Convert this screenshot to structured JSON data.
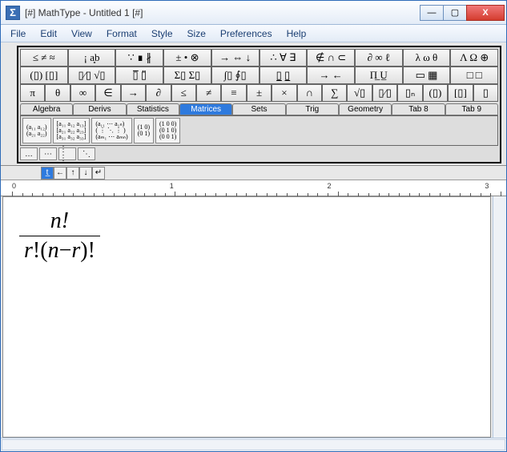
{
  "window": {
    "title": "[#] MathType - Untitled 1 [#]",
    "app_icon": "Σ"
  },
  "winbtns": {
    "min": "—",
    "max": "▢",
    "close": "X"
  },
  "menubar": [
    "File",
    "Edit",
    "View",
    "Format",
    "Style",
    "Size",
    "Preferences",
    "Help"
  ],
  "palette_rows": [
    [
      "≤ ≠ ≈",
      "¡ a͈b",
      "∵ ∎ ∦",
      "± • ⊗",
      "→ ⇔ ↓",
      "∴ ∀ ∃",
      "∉ ∩ ⊂",
      "∂ ∞ ℓ",
      "λ ω θ",
      "Λ Ω ⊕"
    ],
    [
      "(▯) [▯]",
      "▯⁄▯ √▯",
      "▯̅  ▯̈",
      "Σ▯ Σ▯",
      "∫▯ ∮▯",
      "▯̲  ▯̲",
      "→ ←",
      "Π̲  U̲",
      "▭ ▦",
      "□ □"
    ],
    [
      "π",
      "θ",
      "∞",
      "∈",
      "→",
      "∂",
      "≤",
      "≠",
      "≡",
      "±",
      "×",
      "∩",
      "∑",
      "√▯",
      "▯⁄▯",
      "▯ₙ",
      "(▯)",
      "[▯]",
      "▯"
    ]
  ],
  "tabs": [
    "Algebra",
    "Derivs",
    "Statistics",
    "Matrices",
    "Sets",
    "Trig",
    "Geometry",
    "Tab 8",
    "Tab 9"
  ],
  "active_tab_index": 3,
  "matrix_templates": [
    "(a₁₁ a₁₂)\n(a₂₁ a₂₂)",
    "[a₁₁ a₁₂ a₁₃]\n[a₂₁ a₂₂ a₂₃]\n[a₃₁ a₃₂ a₃₃]",
    "(a₁₁ ⋯ a₁ₙ)\n( ⋮ ⋱ ⋮ )\n(aₘ₁ ⋯ aₘₙ)",
    "(1 0)\n(0 1)",
    "(1 0 0)\n(0 1 0)\n(0 0 1)"
  ],
  "small_palette": [
    "…",
    "⋯",
    "⋮ ⋮",
    "⋱"
  ],
  "opt_buttons": [
    "t̲",
    "←",
    "↑",
    "↓",
    "↵"
  ],
  "ruler": {
    "marks": [
      "0",
      "1",
      "2",
      "3"
    ]
  },
  "formula": {
    "numerator": "n!",
    "denom_r": "r",
    "denom_excl1": "!",
    "denom_open": "(",
    "denom_n": "n",
    "denom_minus": "−",
    "denom_r2": "r",
    "denom_close": ")",
    "denom_excl2": "!"
  }
}
